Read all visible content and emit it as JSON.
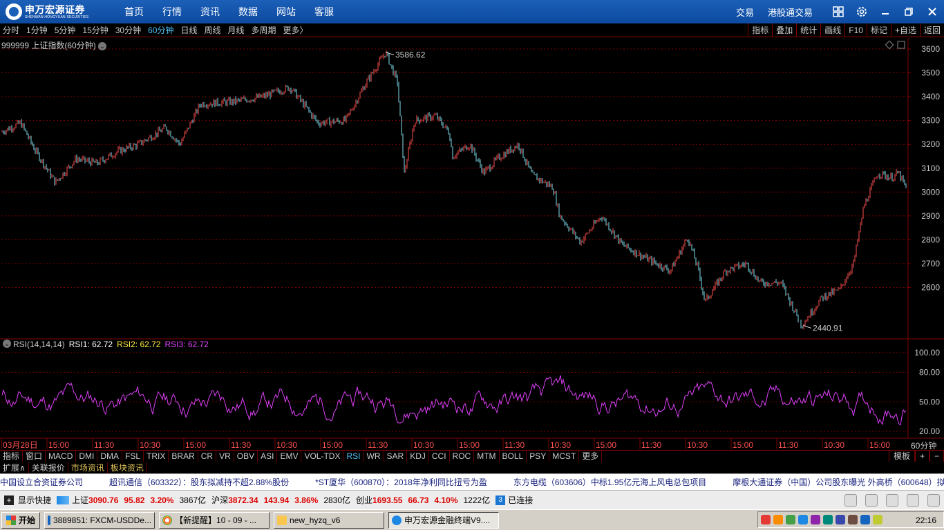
{
  "header": {
    "logo_cn": "申万宏源证券",
    "logo_en": "SHENWAN HONGYUAN SECURITIES",
    "nav": [
      "首页",
      "行情",
      "资讯",
      "数据",
      "网站",
      "客服"
    ],
    "right_links": [
      "交易",
      "港股通交易"
    ]
  },
  "periodbar": {
    "periods": [
      "分时",
      "1分钟",
      "5分钟",
      "15分钟",
      "30分钟",
      "60分钟",
      "日线",
      "周线",
      "月线",
      "多周期",
      "更多〉"
    ],
    "active": "60分钟",
    "right_buttons": [
      "指标",
      "叠加",
      "统计",
      "画线",
      "F10",
      "标记",
      "+自选",
      "返回"
    ]
  },
  "main_panel": {
    "title": "999999 上证指数(60分钟)",
    "high_label": "3586.62",
    "low_label": "2440.91",
    "y_ticks": [
      "3600",
      "3500",
      "3400",
      "3300",
      "3200",
      "3100",
      "3000",
      "2900",
      "2800",
      "2700",
      "2600"
    ]
  },
  "rsi_panel": {
    "title": "RSI(14,14,14)",
    "rsi1": "RSI1: 62.72",
    "rsi2": "RSI2: 62.72",
    "rsi3": "RSI3: 62.72",
    "y_ticks": [
      "100.00",
      "80.00",
      "50.00",
      "20.00"
    ]
  },
  "time_axis": {
    "labels": [
      "03月28日",
      "15:00",
      "11:30",
      "10:30",
      "15:00",
      "11:30",
      "10:30",
      "15:00",
      "11:30",
      "10:30",
      "15:00",
      "11:30",
      "10:30",
      "15:00",
      "11:30",
      "10:30",
      "15:00",
      "11:30",
      "10:30",
      "15:00"
    ],
    "period_label": "60分钟"
  },
  "indicator_tabs": {
    "items": [
      "指标",
      "窗口",
      "MACD",
      "DMI",
      "DMA",
      "FSL",
      "TRIX",
      "BRAR",
      "CR",
      "VR",
      "OBV",
      "ASI",
      "EMV",
      "VOL-TDX",
      "RSI",
      "WR",
      "SAR",
      "KDJ",
      "CCI",
      "ROC",
      "MTM",
      "BOLL",
      "PSY",
      "MCST",
      "更多"
    ],
    "active": "RSI",
    "right": [
      "模板",
      "+",
      "−"
    ]
  },
  "expand_bar": {
    "items": [
      "扩展∧",
      "关联报价",
      "市场资讯",
      "板块资讯"
    ]
  },
  "ticker": [
    "中国设立合资证券公司",
    "超讯通信（603322）：股东拟减持不超2.88%股份",
    "*ST厦华（600870）：2018年净利同比扭亏为盈",
    "东方电缆（603606）中标1.95亿元海上风电总包项目",
    "摩根大通证券（中国）公司股东曝光 外高桥（600648）拟"
  ],
  "statusbar": {
    "show_shortcut": "显示快捷",
    "sh_label": "上证",
    "sh_value": "3090.76",
    "sh_change": "95.82",
    "sh_pct": "3.20%",
    "sh_amount": "3867亿",
    "hs_label": "沪深",
    "hs_value": "3872.34",
    "hs_change": "143.94",
    "hs_pct": "3.86%",
    "hs_amount": "2830亿",
    "cy_label": "创业",
    "cy_value": "1693.55",
    "cy_change": "66.73",
    "cy_pct": "4.10%",
    "cy_amount": "1222亿",
    "conn_num": "3",
    "conn_text": "已连接"
  },
  "taskbar": {
    "start": "开始",
    "tasks": [
      "3889851: FXCM-USDDe...",
      "【新提醒】10 - 09 - ...",
      "new_hyzq_v6",
      "申万宏源金融终端V9...."
    ],
    "clock": "22:16"
  },
  "colors": {
    "up": "#ff5050",
    "down": "#7fe0f0",
    "rsi": "#e040fb",
    "grid": "#800000"
  }
}
